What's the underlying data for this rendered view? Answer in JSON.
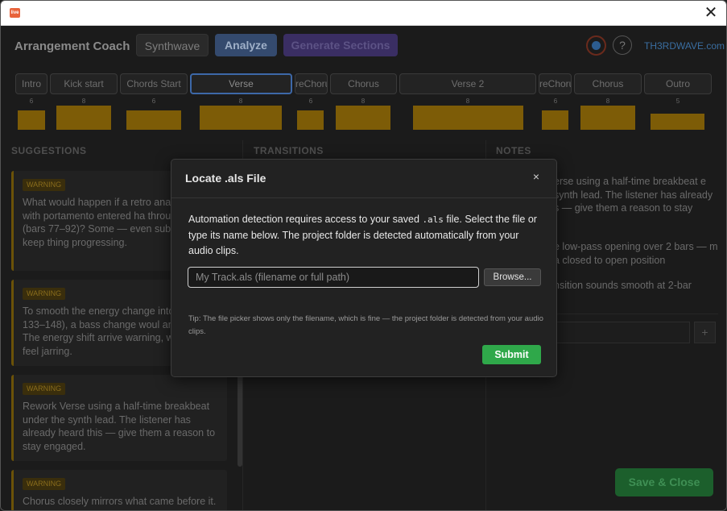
{
  "window": {
    "close_glyph": "✕",
    "app_icon_label": "live"
  },
  "header": {
    "title": "Arrangement Coach",
    "style_button": "Synthwave",
    "analyze_button": "Analyze",
    "generate_button": "Generate Sections",
    "help_glyph": "?",
    "site_link": "TH3RDWAVE.com"
  },
  "sections": [
    {
      "name": "Intro",
      "bars": 6
    },
    {
      "name": "Kick start",
      "bars": 8
    },
    {
      "name": "Chords Start",
      "bars": 6
    },
    {
      "name": "Verse",
      "bars": 8,
      "selected": true
    },
    {
      "name": "reChorus",
      "bars": 6
    },
    {
      "name": "Chorus",
      "bars": 8
    },
    {
      "name": "Verse 2",
      "bars": 8
    },
    {
      "name": "reChorus",
      "bars": 6
    },
    {
      "name": "Chorus",
      "bars": 8
    },
    {
      "name": "Outro",
      "bars": 5
    }
  ],
  "columns": {
    "suggestions": "SUGGESTIONS",
    "transitions": "TRANSITIONS",
    "notes": "NOTES"
  },
  "suggestions": [
    {
      "badge": "WARNING",
      "text": "What would happen if a retro analo sweep with portamento entered ha through Chorus (bars 77–92)? Some — even subtle — would keep thing progressing."
    },
    {
      "badge": "WARNING",
      "text": "To smooth the energy change into (bars 133–148), a bass change woul anticipation. The energy shift arrive warning, which can feel jarring."
    },
    {
      "badge": "WARNING",
      "text": "Rework Verse using a half-time breakbeat under the synth lead. The listener has already heard this — give them a reason to stay engaged."
    },
    {
      "badge": "WARNING",
      "text": "Chorus closely mirrors what came before it."
    }
  ],
  "notes": {
    "items": [
      "erse using a half-time breakbeat e synth lead. The listener has already s — give them a reason to stay",
      "e low-pass opening over 2 bars — m a closed to open position",
      "nsition sounds smooth at 2-bar"
    ],
    "add_glyph": "+"
  },
  "save_close": "Save & Close",
  "modal": {
    "title": "Locate .als File",
    "close_glyph": "×",
    "desc_before": "Automation detection requires access to your saved ",
    "desc_code": ".als",
    "desc_after": " file. Select the file or type its name below. The project folder is detected automatically from your audio clips.",
    "input_placeholder": "My Track.als (filename or full path)",
    "input_value": "",
    "browse_button": "Browse...",
    "tip": "Tip: The file picker shows only the filename, which is fine — the project folder is detected from your audio clips.",
    "submit_button": "Submit"
  },
  "colors": {
    "accent_blue": "#3d68a8",
    "submit_green": "#2fa84a",
    "warning_amber": "#7d5c07"
  }
}
